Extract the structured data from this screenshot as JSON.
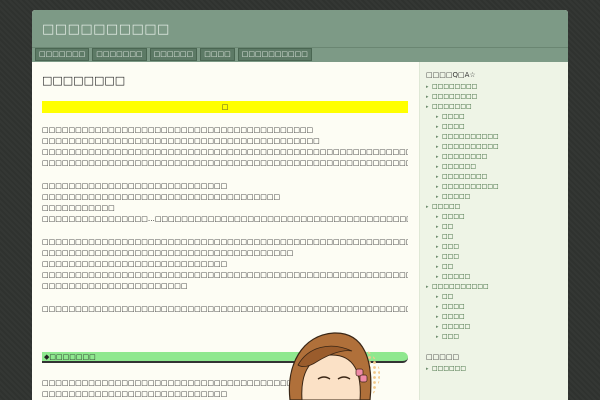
{
  "site": {
    "title": "□□□□□□□□□□"
  },
  "nav": [
    {
      "label": "□□□□□□□"
    },
    {
      "label": "□□□□□□□"
    },
    {
      "label": "□□□□□□"
    },
    {
      "label": "□□□□"
    },
    {
      "label": "□□□□□□□□□□"
    }
  ],
  "post": {
    "title": "□□□□□□□□",
    "yellow_text": "□",
    "paragraphs": [
      [
        "□□□□□□□□□□□□□□□□□□□□□□□□□□□□□□□□□□□□□□□□□",
        "□□□□□□□□□□□□□□□□□□□□□□□□□□□□□□□□□□□□□□□□□□",
        "□□□□□□□□□□□□□□□□□□□□□□□□□□□□□□□□□□□□□□□□□□□□□□□□□□□□□□□□□□□□□□□□□□□□□□□□□□□□□□□□□□□□□□□□□",
        "□□□□□□□□□□□□□□□□□□□□□□□□□□□□□□□□□□□□□□□□□□□□□□□□□□□□□□□□□□□□□□□□□□□□□□□□"
      ],
      [
        "□□□□□□□□□□□□□□□□□□□□□□□□□□□□",
        "□□□□□□□□□□□□□□□□□□□□□□□□□□□□□□□□□□□□",
        "□□□□□□□□□□□",
        "□□□□□□□□□□□□□□□□…□□□□□□□□□□□□□□□□□□□□□□□□□□□□□□□□□□□□□□□□□□□□□"
      ],
      [
        "□□□□□□□□□□□□□□□□□□□□□□□□□□□□□□□□□□□□□□□□□□□□□□□□□□□□□□□□□□□□□□□□□□□□□□",
        "□□□□□□□□□□□□□□□□□□□□□□□□□□□□□□□□□□□□□□",
        "□□□□□□□□□□□□□□□□□□□□□□□□□□□□",
        "□□□□□□□□□□□□□□□□□□□□□□□□□□□□□□□□□□□□□□□□□□□□□□□□□□□□□□□□□□□□□□□□□□□□□□□□□□□□□□□□□□□□□□□□□",
        "□□□□□□□□□□□□□□□□□□□□□□"
      ],
      [
        "□□□□□□□□□□□□□□□□□□□□□□□□□□□□□□□□□□□□□□□□□□□□□□□□□□□□□□□□□□□"
      ]
    ],
    "green_heading": "◆□□□□□□□",
    "after_green": [
      "□□□□□□□□□□□□□□□□□□□□□□□□□□□□□□□□□□□□□□□□□",
      "□□□□□□□□□□□□□□□□□□□□□□□□□□□□"
    ]
  },
  "sidebar": {
    "heading1": "□□□□Q□A☆",
    "items": [
      {
        "label": "□□□□□□□□",
        "sub": false
      },
      {
        "label": "□□□□□□□□",
        "sub": false
      },
      {
        "label": "□□□□□□□",
        "sub": false
      },
      {
        "label": "□□□□",
        "sub": true
      },
      {
        "label": "□□□□",
        "sub": true
      },
      {
        "label": "□□□□□□□□□□",
        "sub": true
      },
      {
        "label": "□□□□□□□□□□",
        "sub": true
      },
      {
        "label": "□□□□□□□□",
        "sub": true
      },
      {
        "label": "□□□□□□",
        "sub": true
      },
      {
        "label": "□□□□□□□□",
        "sub": true
      },
      {
        "label": "□□□□□□□□□□",
        "sub": true
      },
      {
        "label": "□□□□□",
        "sub": true
      },
      {
        "label": "□□□□□",
        "sub": false
      },
      {
        "label": "□□□□",
        "sub": true
      },
      {
        "label": "□□",
        "sub": true
      },
      {
        "label": "□□",
        "sub": true
      },
      {
        "label": "□□□",
        "sub": true
      },
      {
        "label": "□□□",
        "sub": true
      },
      {
        "label": "□□",
        "sub": true
      },
      {
        "label": "□□□□□",
        "sub": true
      },
      {
        "label": "□□□□□□□□□□",
        "sub": false
      },
      {
        "label": "□□",
        "sub": true
      },
      {
        "label": "□□□□",
        "sub": true
      },
      {
        "label": "□□□□",
        "sub": true
      },
      {
        "label": "□□□□□",
        "sub": true
      },
      {
        "label": "□□□",
        "sub": true
      }
    ],
    "heading2": "□□□□□",
    "items2": [
      {
        "label": "□□□□□□",
        "sub": false
      }
    ]
  },
  "colors": {
    "header": "#7d9a86",
    "nav_button": "#5d7a66",
    "highlight_yellow": "#ffff00",
    "highlight_green": "#8fe88f",
    "sidebar_bg": "#eef4e6",
    "link": "#1a4d1a"
  },
  "icons": {
    "avatar": "character-avatar-icon"
  }
}
